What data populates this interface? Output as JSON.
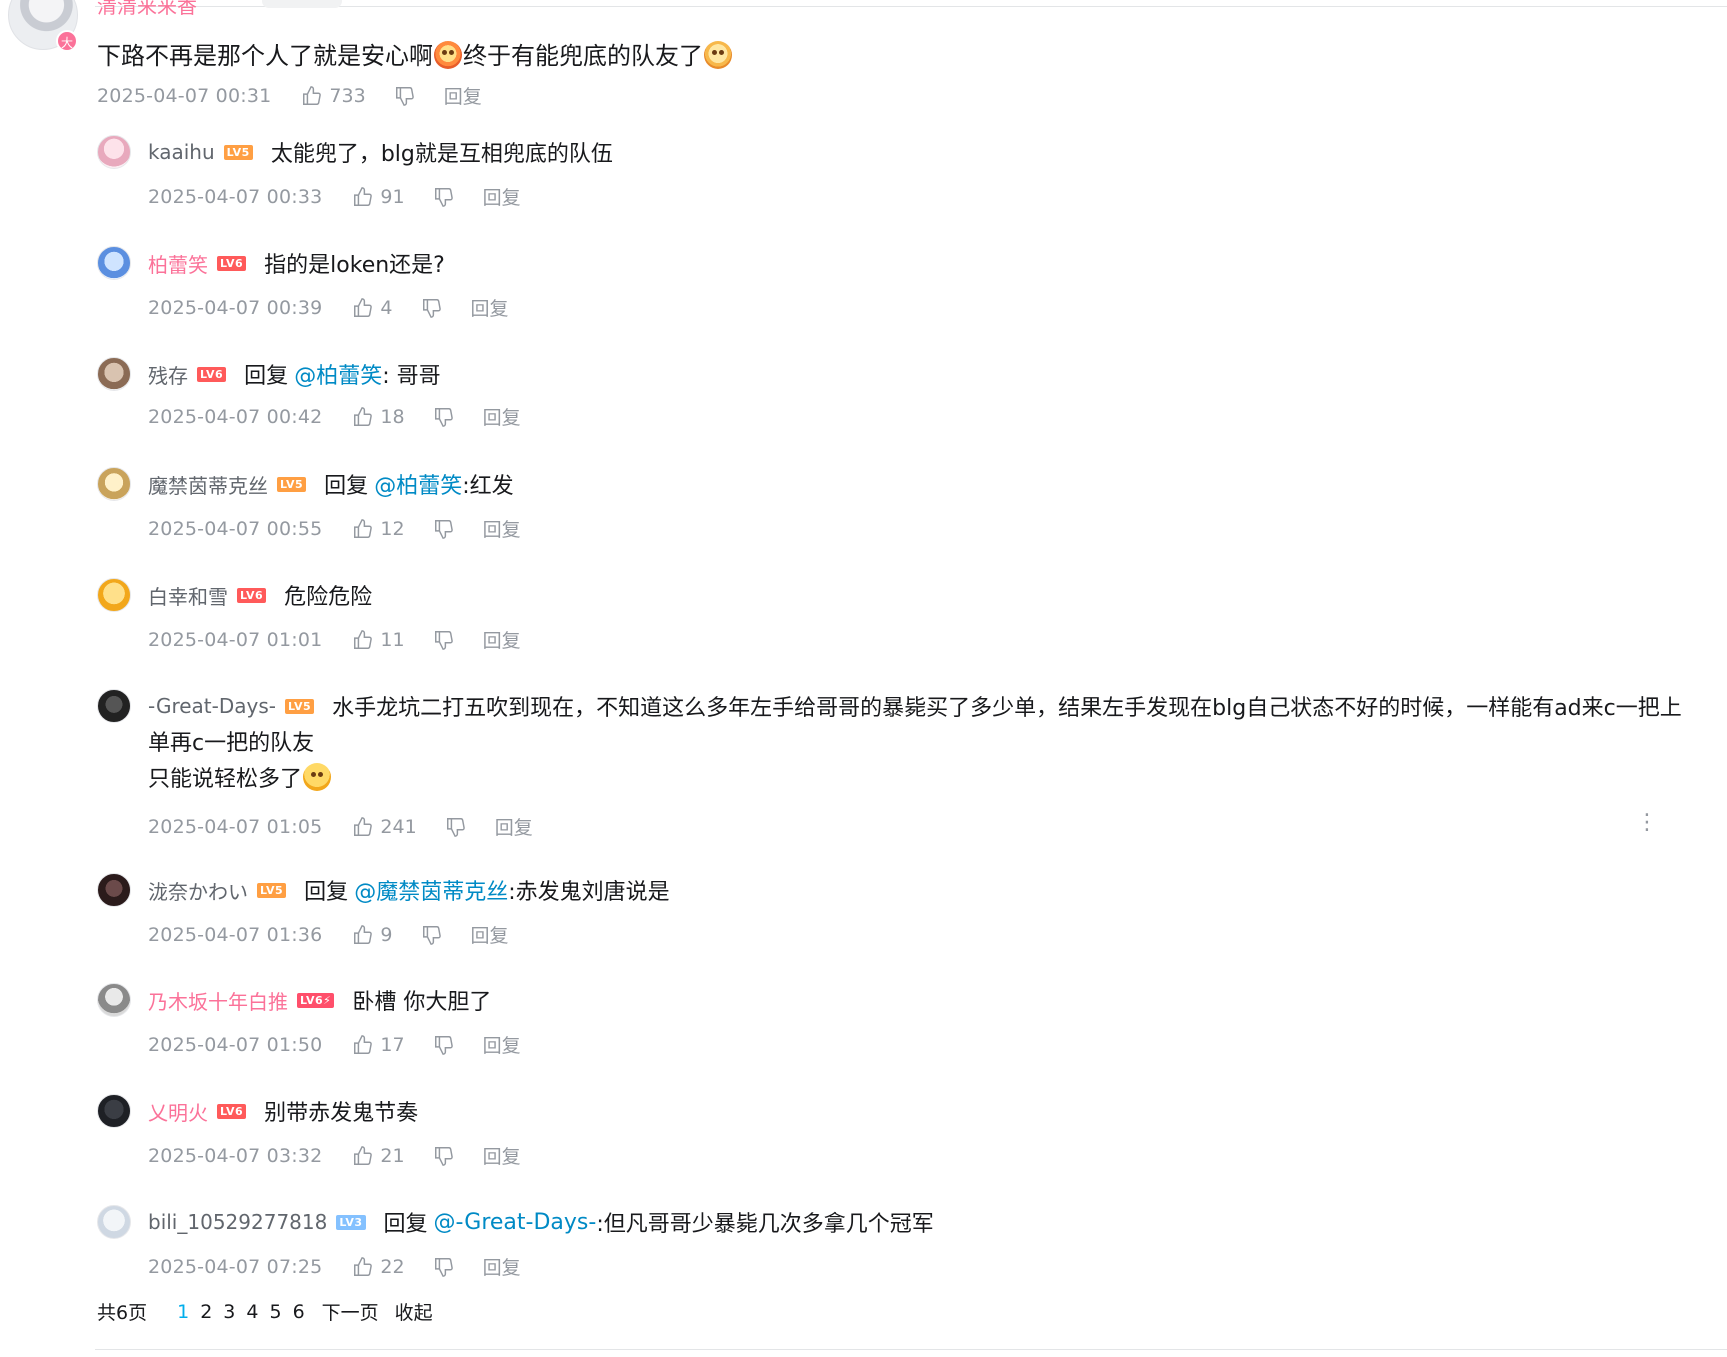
{
  "root": {
    "name": "清清来来香",
    "badge": "大",
    "text_before": "下路不再是那个人了就是安心啊",
    "text_middle": "终于有能兜底的队友了",
    "time": "2025-04-07 00:31",
    "likes": "733",
    "reply_label": "回复"
  },
  "replies": [
    {
      "user": "kaaihu",
      "level": "LV5",
      "content": "太能兜了，blg就是互相兜底的队伍",
      "time": "2025-04-07 00:33",
      "likes": "91",
      "reply_label": "回复"
    },
    {
      "user": "柏蕾笑",
      "level": "LV6",
      "content": "指的是loken还是?",
      "time": "2025-04-07 00:39",
      "likes": "4",
      "reply_label": "回复"
    },
    {
      "user": "残存",
      "level": "LV6",
      "reply_word": "回复",
      "at": "@柏蕾笑",
      "content": " : 哥哥",
      "time": "2025-04-07 00:42",
      "likes": "18",
      "reply_label": "回复"
    },
    {
      "user": "魔禁茵蒂克丝",
      "level": "LV5",
      "reply_word": "回复",
      "at": "@柏蕾笑",
      "content": " :红发",
      "time": "2025-04-07 00:55",
      "likes": "12",
      "reply_label": "回复"
    },
    {
      "user": "白幸和雪",
      "level": "LV6",
      "content": "危险危险",
      "time": "2025-04-07 01:01",
      "likes": "11",
      "reply_label": "回复"
    },
    {
      "user": "-Great-Days-",
      "level": "LV5",
      "content": "水手龙坑二打五吹到现在，不知道这么多年左手给哥哥的暴毙买了多少单，结果左手发现在blg自己状态不好的时候，一样能有ad来c一把上",
      "content_line2": "单再c一把的队友",
      "content_line3": "只能说轻松多了",
      "time": "2025-04-07 01:05",
      "likes": "241",
      "reply_label": "回复"
    },
    {
      "user": "泷奈かわい",
      "level": "LV5",
      "reply_word": "回复",
      "at": "@魔禁茵蒂克丝",
      "content": " :赤发鬼刘唐说是",
      "time": "2025-04-07 01:36",
      "likes": "9",
      "reply_label": "回复"
    },
    {
      "user": "乃木坂十年白推",
      "level": "LV6⚡",
      "content": "卧槽 你大胆了",
      "time": "2025-04-07 01:50",
      "likes": "17",
      "reply_label": "回复"
    },
    {
      "user": "乂明火",
      "level": "LV6",
      "content": "别带赤发鬼节奏",
      "time": "2025-04-07 03:32",
      "likes": "21",
      "reply_label": "回复"
    },
    {
      "user": "bili_10529277818",
      "level": "LV3",
      "reply_word": "回复",
      "at": "@-Great-Days-",
      "content": " :但凡哥哥少暴毙几次多拿几个冠军",
      "time": "2025-04-07 07:25",
      "likes": "22",
      "reply_label": "回复"
    }
  ],
  "pager": {
    "total": "共6页",
    "pages": [
      "1",
      "2",
      "3",
      "4",
      "5",
      "6"
    ],
    "next": "下一页",
    "collapse": "收起"
  },
  "colors": {
    "link": "#008ac5",
    "vip_name": "#fb7299",
    "meta": "#9499a0",
    "current_page": "#00aeec"
  }
}
